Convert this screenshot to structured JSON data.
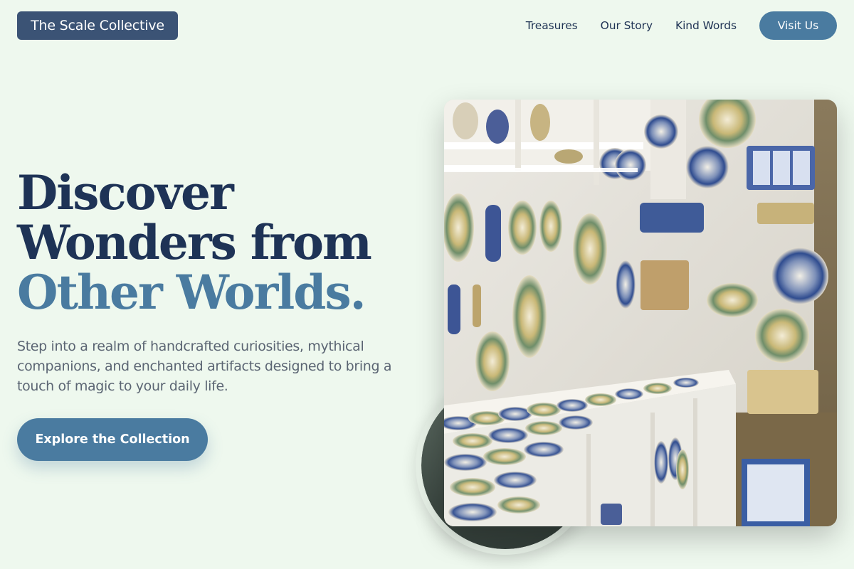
{
  "nav": {
    "logo": "The Scale Collective",
    "links": [
      "Treasures",
      "Our Story",
      "Kind Words"
    ],
    "cta": "Visit Us"
  },
  "hero": {
    "headline_line1": "Discover",
    "headline_line2": "Wonders from",
    "headline_accent": "Other Worlds.",
    "subtext": "Step into a realm of handcrafted curiosities, mythical companions, and enchanted artifacts designed to bring a touch of magic to your daily life.",
    "cta": "Explore the Collection"
  },
  "images": {
    "main_photo": "ceramics-shop-photo",
    "circle_photo": "circular-inset-photo"
  },
  "colors": {
    "background": "#eef8ee",
    "navy": "#1e3356",
    "accent": "#4a7ba0",
    "logo_bg": "#3b5375"
  }
}
